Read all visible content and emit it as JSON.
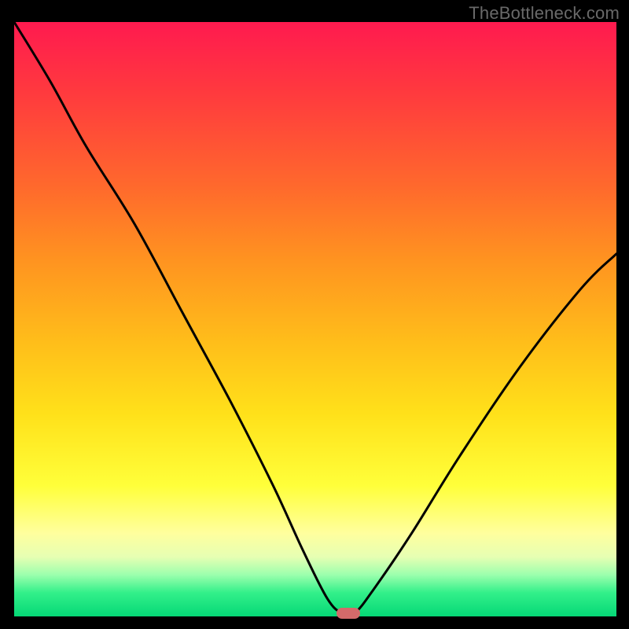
{
  "watermark": {
    "text": "TheBottleneck.com"
  },
  "colors": {
    "curve_stroke": "#000000",
    "marker_fill": "#d46a6a",
    "frame_bg": "#000000"
  },
  "chart_data": {
    "type": "line",
    "title": "",
    "xlabel": "",
    "ylabel": "",
    "xlim": [
      0,
      100
    ],
    "ylim": [
      0,
      100
    ],
    "grid": false,
    "legend": false,
    "series": [
      {
        "name": "bottleneck-curve",
        "x": [
          0,
          6,
          12,
          20,
          28,
          36,
          43,
          48,
          52,
          54.5,
          56.5,
          60,
          66,
          74,
          84,
          94,
          100
        ],
        "values": [
          100,
          90,
          79,
          66,
          51,
          36,
          22,
          11,
          3,
          0.5,
          0.5,
          5,
          14,
          27,
          42,
          55,
          61
        ]
      }
    ],
    "markers": [
      {
        "name": "target-point",
        "x": 55.5,
        "y": 0.5
      }
    ],
    "gradient_stops": [
      {
        "pos": 0,
        "color": "#ff1a4f"
      },
      {
        "pos": 12,
        "color": "#ff3a3e"
      },
      {
        "pos": 28,
        "color": "#ff6a2c"
      },
      {
        "pos": 40,
        "color": "#ff9320"
      },
      {
        "pos": 54,
        "color": "#ffbe1a"
      },
      {
        "pos": 66,
        "color": "#ffe11a"
      },
      {
        "pos": 78,
        "color": "#ffff3a"
      },
      {
        "pos": 86,
        "color": "#ffff9e"
      },
      {
        "pos": 90,
        "color": "#e6ffb3"
      },
      {
        "pos": 93,
        "color": "#9cffad"
      },
      {
        "pos": 96,
        "color": "#33f08a"
      },
      {
        "pos": 100,
        "color": "#05d876"
      }
    ]
  }
}
